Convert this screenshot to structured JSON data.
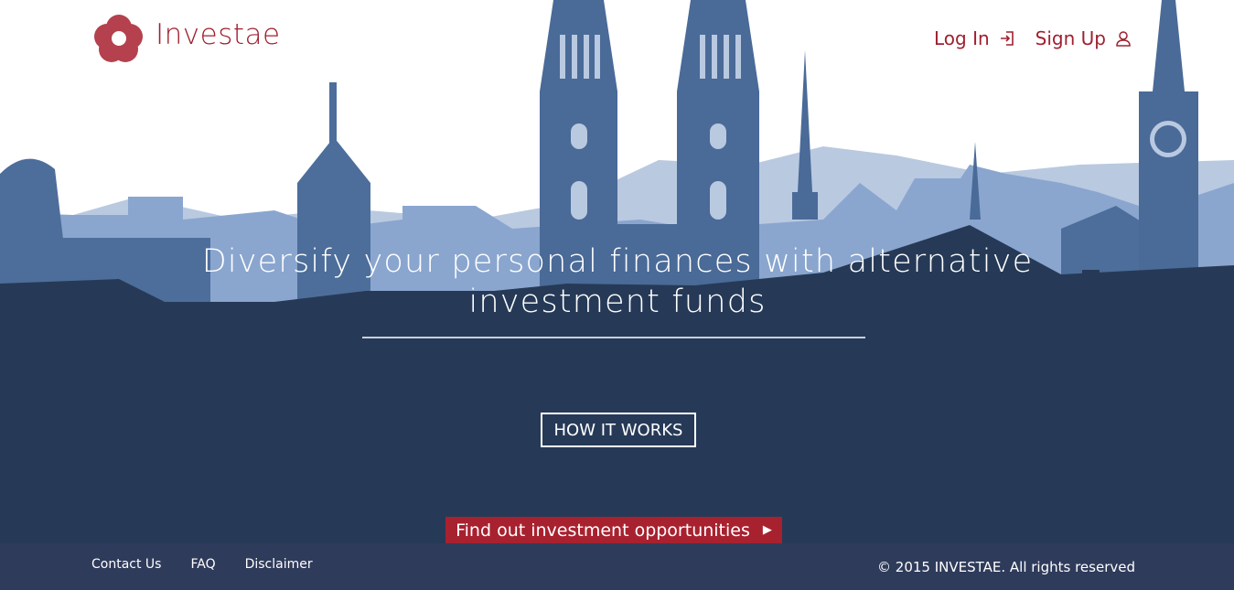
{
  "brand": {
    "name": "Investae"
  },
  "nav": {
    "login": "Log In",
    "signup": "Sign Up"
  },
  "hero": {
    "title_line1": "Diversify your personal finances with alternative",
    "title_line2": "investment funds",
    "how_button": "HOW IT WORKS",
    "cta": "Find out investment opportunities",
    "cta_arrow": "▶"
  },
  "footer": {
    "links": [
      "Contact Us",
      "FAQ",
      "Disclaimer"
    ],
    "copyright": "© 2015 INVESTAE. All rights reserved"
  },
  "colors": {
    "brand_red": "#a0202f",
    "sky_far": "#b8c8e0",
    "sky_mid": "#6f8fbf",
    "city_dark": "#3e5f8c",
    "ground": "#263a57",
    "footer": "#2f3b5a"
  }
}
